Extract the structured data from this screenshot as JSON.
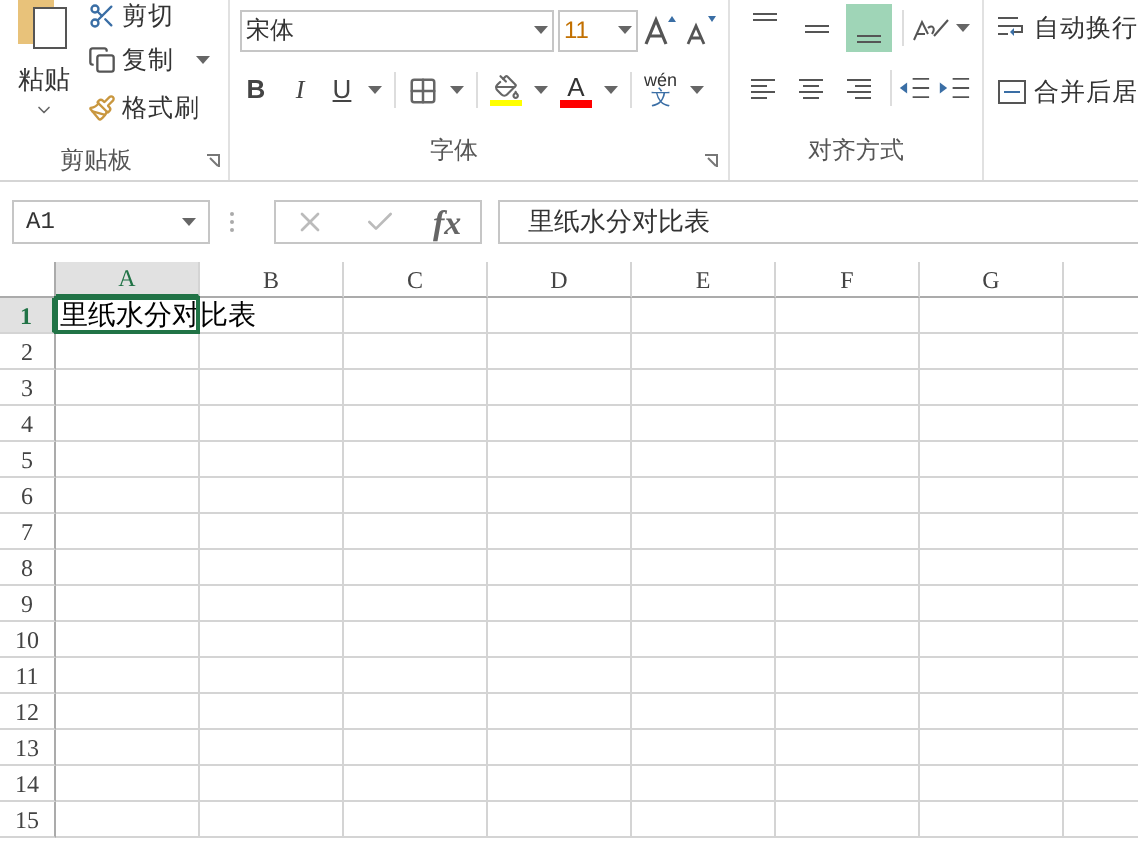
{
  "ribbon": {
    "clipboard": {
      "paste": "粘贴",
      "cut": "剪切",
      "copy": "复制",
      "format_painter": "格式刷",
      "group_label": "剪贴板"
    },
    "font": {
      "font_name": "宋体",
      "font_size": "11",
      "bold": "B",
      "italic": "I",
      "underline": "U",
      "font_color_letter": "A",
      "phonetic_top": "wén",
      "phonetic_bottom": "文",
      "group_label": "字体"
    },
    "alignment": {
      "vertical": [
        {
          "kind": "top",
          "selected": false
        },
        {
          "kind": "middle",
          "selected": false
        },
        {
          "kind": "bottom",
          "selected": true
        }
      ],
      "wrap_text": "自动换行",
      "merge": "合并后居",
      "group_label": "对齐方式"
    }
  },
  "formula_bar": {
    "name_box": "A1",
    "fx": "fx",
    "formula": "里纸水分对比表"
  },
  "sheet": {
    "columns": [
      {
        "label": "A",
        "selected": true
      },
      {
        "label": "B",
        "selected": false
      },
      {
        "label": "C",
        "selected": false
      },
      {
        "label": "D",
        "selected": false
      },
      {
        "label": "E",
        "selected": false
      },
      {
        "label": "F",
        "selected": false
      },
      {
        "label": "G",
        "selected": false
      }
    ],
    "rows": [
      {
        "header": "1",
        "selected": true,
        "cells": [
          {
            "text": "里纸水分对比表",
            "selected": true
          }
        ]
      },
      {
        "header": "2",
        "selected": false
      },
      {
        "header": "3",
        "selected": false
      },
      {
        "header": "4",
        "selected": false
      },
      {
        "header": "5",
        "selected": false
      },
      {
        "header": "6",
        "selected": false
      },
      {
        "header": "7",
        "selected": false
      },
      {
        "header": "8",
        "selected": false
      },
      {
        "header": "9",
        "selected": false
      },
      {
        "header": "10",
        "selected": false
      },
      {
        "header": "11",
        "selected": false
      },
      {
        "header": "12",
        "selected": false
      },
      {
        "header": "13",
        "selected": false
      },
      {
        "header": "14",
        "selected": false
      },
      {
        "header": "15",
        "selected": false
      }
    ]
  }
}
